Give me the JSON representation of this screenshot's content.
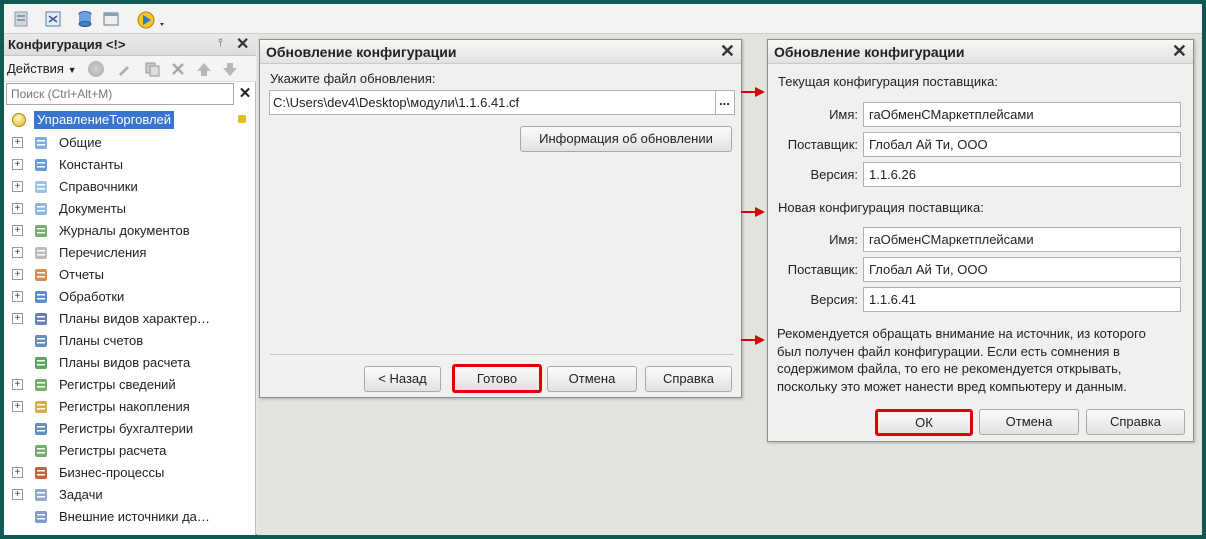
{
  "left_panel": {
    "title": "Конфигурация <!>",
    "actions_label": "Действия",
    "search_placeholder": "Поиск (Ctrl+Alt+M)",
    "root_label": "УправлениеТорговлей",
    "items": [
      {
        "label": "Общие",
        "icon": "common-icon"
      },
      {
        "label": "Константы",
        "icon": "constants-icon"
      },
      {
        "label": "Справочники",
        "icon": "catalogs-icon"
      },
      {
        "label": "Документы",
        "icon": "documents-icon"
      },
      {
        "label": "Журналы документов",
        "icon": "journals-icon"
      },
      {
        "label": "Перечисления",
        "icon": "enums-icon"
      },
      {
        "label": "Отчеты",
        "icon": "reports-icon"
      },
      {
        "label": "Обработки",
        "icon": "processing-icon"
      },
      {
        "label": "Планы видов характер…",
        "icon": "char-plans-icon"
      },
      {
        "label": "Планы счетов",
        "icon": "accounts-icon"
      },
      {
        "label": "Планы видов расчета",
        "icon": "calc-plans-icon"
      },
      {
        "label": "Регистры сведений",
        "icon": "info-registers-icon"
      },
      {
        "label": "Регистры накопления",
        "icon": "accum-registers-icon"
      },
      {
        "label": "Регистры бухгалтерии",
        "icon": "account-registers-icon"
      },
      {
        "label": "Регистры расчета",
        "icon": "calc-registers-icon"
      },
      {
        "label": "Бизнес-процессы",
        "icon": "business-process-icon"
      },
      {
        "label": "Задачи",
        "icon": "tasks-icon"
      },
      {
        "label": "Внешние источники да…",
        "icon": "external-sources-icon"
      }
    ]
  },
  "dialog1": {
    "title": "Обновление конфигурации",
    "file_label": "Укажите файл обновления:",
    "file_value": "C:\\Users\\dev4\\Desktop\\модули\\1.1.6.41.cf",
    "browse": "...",
    "info_button": "Информация об обновлении",
    "back_button": "< Назад",
    "done_button": "Готово",
    "cancel_button": "Отмена",
    "help_button": "Справка"
  },
  "dialog2": {
    "title": "Обновление конфигурации",
    "current_heading": "Текущая конфигурация поставщика:",
    "new_heading": "Новая конфигурация поставщика:",
    "name_label": "Имя:",
    "vendor_label": "Поставщик:",
    "version_label": "Версия:",
    "current": {
      "name": "гаОбменСМаркетплейсами",
      "vendor": "Глобал Ай Ти, ООО",
      "version": "1.1.6.26"
    },
    "new": {
      "name": "гаОбменСМаркетплейсами",
      "vendor": "Глобал Ай Ти, ООО",
      "version": "1.1.6.41"
    },
    "warning_lines": [
      "Рекомендуется обращать внимание на источник, из которого",
      "был получен файл конфигурации. Если есть сомнения в",
      "содержимом файла, то его не рекомендуется открывать,",
      "поскольку это может нанести вред компьютеру и данным."
    ],
    "ok_button": "ОК",
    "cancel_button": "Отмена",
    "help_button": "Справка"
  },
  "colors": {
    "highlight": "#e00000",
    "selection": "#3874d0",
    "frame": "#0f5a55"
  }
}
